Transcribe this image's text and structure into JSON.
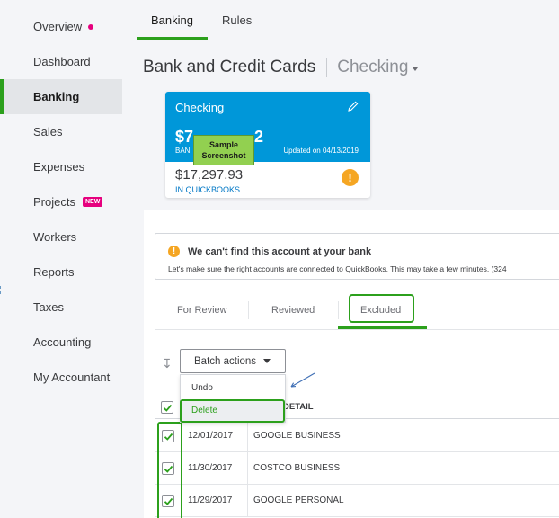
{
  "sidebar": {
    "items": [
      {
        "label": "Overview"
      },
      {
        "label": "Dashboard"
      },
      {
        "label": "Banking"
      },
      {
        "label": "Sales"
      },
      {
        "label": "Expenses"
      },
      {
        "label": "Projects",
        "badge": "NEW"
      },
      {
        "label": "Workers"
      },
      {
        "label": "Reports"
      },
      {
        "label": "Taxes"
      },
      {
        "label": "Accounting"
      },
      {
        "label": "My Accountant"
      }
    ],
    "active": "Banking"
  },
  "topnav": {
    "tabs": [
      {
        "label": "Banking"
      },
      {
        "label": "Rules"
      }
    ],
    "active": "Banking"
  },
  "page": {
    "title": "Bank and Credit Cards",
    "account": "Checking"
  },
  "card": {
    "name": "Checking",
    "bank_balance": "$7",
    "bank_balance_tail": "2",
    "bank_label": "BAN",
    "updated": "Updated on 04/13/2019",
    "qb_balance": "$17,297.93",
    "qb_label": "IN QUICKBOOKS",
    "overlay_line1": "Sample",
    "overlay_line2": "Screenshot"
  },
  "alert": {
    "title": "We can't find this account at your bank",
    "body": "Let's make sure the right accounts are connected to QuickBooks. This may take a few minutes. (324"
  },
  "subtabs": [
    {
      "label": "For Review"
    },
    {
      "label": "Reviewed"
    },
    {
      "label": "Excluded"
    }
  ],
  "batch": {
    "label": "Batch actions",
    "menu": [
      {
        "label": "Undo"
      },
      {
        "label": "Delete"
      }
    ]
  },
  "table": {
    "detail_header": "DETAIL",
    "rows": [
      {
        "date": "12/01/2017",
        "desc": "GOOGLE BUSINESS",
        "checked": true
      },
      {
        "date": "11/30/2017",
        "desc": "COSTCO BUSINESS",
        "checked": true
      },
      {
        "date": "11/29/2017",
        "desc": "GOOGLE PERSONAL",
        "checked": true
      }
    ]
  },
  "colors": {
    "brand_green": "#2ca01c",
    "card_blue": "#0097d9",
    "warning": "#f5a623",
    "badge": "#e6007e",
    "highlight_overlay": "#92d050"
  }
}
